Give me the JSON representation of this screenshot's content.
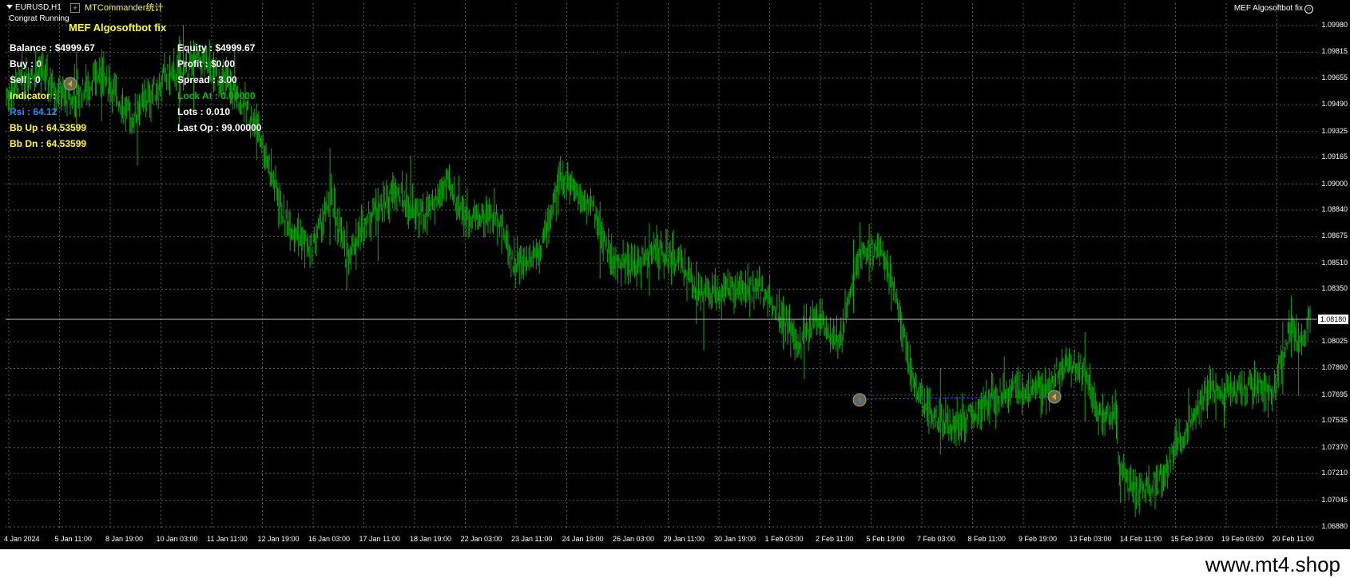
{
  "chart": {
    "symbol": "EURUSD,H1",
    "plugin_label": "MTCommander统计",
    "ea_status": "Congrat Running",
    "ea_title": "MEF Algosoftbot fix",
    "ea_corner": "MEF Algosoftbot fix",
    "current_price": "1.08180",
    "price_ticks": [
      "1.09980",
      "1.09815",
      "1.09655",
      "1.09490",
      "1.09325",
      "1.09165",
      "1.09000",
      "1.08840",
      "1.08675",
      "1.08510",
      "1.08350",
      "1.08025",
      "1.07860",
      "1.07695",
      "1.07535",
      "1.07370",
      "1.07210",
      "1.07045",
      "1.06880"
    ],
    "date_ticks": [
      "4 Jan 2024",
      "5 Jan 11:00",
      "8 Jan 19:00",
      "10 Jan 03:00",
      "11 Jan 11:00",
      "12 Jan 19:00",
      "16 Jan 03:00",
      "17 Jan 11:00",
      "18 Jan 19:00",
      "22 Jan 03:00",
      "23 Jan 11:00",
      "24 Jan 19:00",
      "26 Jan 03:00",
      "29 Jan 11:00",
      "30 Jan 19:00",
      "1 Feb 03:00",
      "2 Feb 11:00",
      "5 Feb 19:00",
      "7 Feb 03:00",
      "8 Feb 11:00",
      "9 Feb 19:00",
      "13 Feb 03:00",
      "14 Feb 11:00",
      "15 Feb 19:00",
      "19 Feb 03:00",
      "20 Feb 11:00"
    ],
    "colors": {
      "bars": "#00b000",
      "grid": "#5a5a5a",
      "trade_line": "#3050ff"
    }
  },
  "panel": {
    "balance": "Balance : $4999.67",
    "buy": "Buy   : 0",
    "sell": "Sell   : 0",
    "indicator": "Indicator :",
    "rsi": "Rsi : 64.12",
    "bb_up": "Bb Up : 64.53599",
    "bb_dn": "Bb Dn : 64.53599",
    "equity": "Equity : $4999.67",
    "profit": "Profit   : $0.00",
    "spread": "Spread   : 3.00",
    "lock_at": "Lock At : 0.00000",
    "lots": "Lots : 0.010",
    "last_op": "Last Op : 99.00000"
  },
  "footer": {
    "watermark": "www.mt4.shop"
  }
}
